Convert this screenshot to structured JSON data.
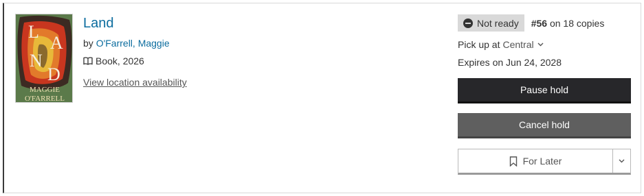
{
  "item": {
    "title": "Land",
    "by_prefix": "by",
    "author": "O'Farrell, Maggie",
    "format": "Book, 2026",
    "availability_link": "View location availability",
    "cover": {
      "title_letters": [
        "L",
        "A",
        "N",
        "D"
      ],
      "author_line_1": "MAGGIE",
      "author_line_2": "O'FARRELL",
      "colors": {
        "bg": "#5b7a4a",
        "red": "#c8361f",
        "orange": "#e27a2b",
        "yellow": "#e8b93a",
        "dark": "#3c2a22"
      }
    }
  },
  "hold": {
    "status": "Not ready",
    "queue_position": "#56",
    "queue_suffix": "on 18 copies",
    "pickup_label": "Pick up at",
    "pickup_location": "Central",
    "expires": "Expires on Jun 24, 2028"
  },
  "actions": {
    "pause": "Pause hold",
    "cancel": "Cancel hold",
    "for_later": "For Later"
  },
  "colors": {
    "link": "#0b6c9e",
    "pause_button": "#27272a",
    "cancel_button": "#5f5f5f",
    "badge_bg": "#d9d9d9"
  }
}
